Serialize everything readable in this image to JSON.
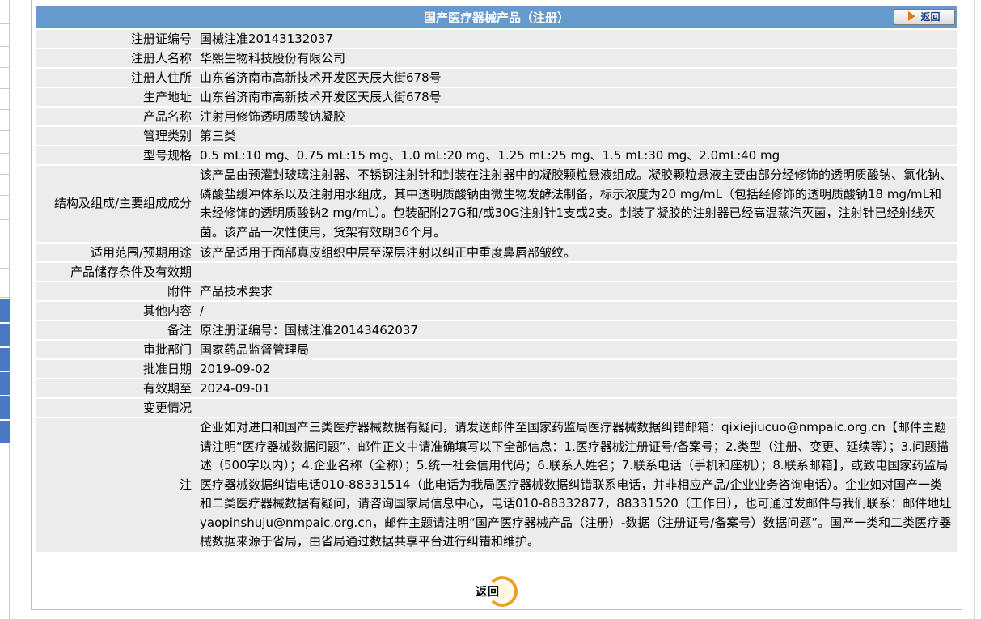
{
  "header": {
    "title": "国产医疗器械产品（注册）",
    "back_button_label": "返回",
    "back_icon": "arrow-right-icon"
  },
  "rows": [
    {
      "label": "注册证编号",
      "value": "国械注准20143132037"
    },
    {
      "label": "注册人名称",
      "value": "华熙生物科技股份有限公司"
    },
    {
      "label": "注册人住所",
      "value": "山东省济南市高新技术开发区天辰大街678号"
    },
    {
      "label": "生产地址",
      "value": "山东省济南市高新技术开发区天辰大街678号"
    },
    {
      "label": "产品名称",
      "value": "注射用修饰透明质酸钠凝胶"
    },
    {
      "label": "管理类别",
      "value": "第三类"
    },
    {
      "label": "型号规格",
      "value": "0.5 mL:10 mg、0.75 mL:15 mg、1.0 mL:20 mg、1.25 mL:25 mg、1.5 mL:30 mg、2.0mL:40 mg"
    },
    {
      "label": "结构及组成/主要组成成分",
      "value": "该产品由预灌封玻璃注射器、不锈钢注射针和封装在注射器中的凝胶颗粒悬液组成。凝胶颗粒悬液主要由部分经修饰的透明质酸钠、氯化钠、磷酸盐缓冲体系以及注射用水组成，其中透明质酸钠由微生物发酵法制备，标示浓度为20 mg/mL（包括经修饰的透明质酸钠18 mg/mL和未经修饰的透明质酸钠2 mg/mL）。包装配附27G和/或30G注射针1支或2支。封装了凝胶的注射器已经高温蒸汽灭菌，注射针已经射线灭菌。该产品一次性使用，货架有效期36个月。"
    },
    {
      "label": "适用范围/预期用途",
      "value": "该产品适用于面部真皮组织中层至深层注射以纠正中重度鼻唇部皱纹。"
    },
    {
      "label": "产品储存条件及有效期",
      "value": ""
    },
    {
      "label": "附件",
      "value": "产品技术要求"
    },
    {
      "label": "其他内容",
      "value": "/"
    },
    {
      "label": "备注",
      "value": "原注册证编号：国械注准20143462037"
    },
    {
      "label": "审批部门",
      "value": "国家药品监督管理局"
    },
    {
      "label": "批准日期",
      "value": "2019-09-02"
    },
    {
      "label": "有效期至",
      "value": "2024-09-01"
    },
    {
      "label": "变更情况",
      "value": ""
    }
  ],
  "note": {
    "label": "注",
    "value": "企业如对进口和国产三类医疗器械数据有疑问，请发送邮件至国家药监局医疗器械数据纠错邮箱：qixiejiucuo@nmpaic.org.cn【邮件主题请注明“医疗器械数据问题”，邮件正文中请准确填写以下全部信息：1.医疗器械注册证号/备案号；2.类型（注册、变更、延续等）；3.问题描述（500字以内）；4.企业名称（全称）；5.统一社会信用代码；6.联系人姓名；7.联系电话（手机和座机）；8.联系邮箱】，或致电国家药监局医疗器械数据纠错电话010-88331514（此电话为我局医疗器械数据纠错联系电话，并非相应产品/企业业务咨询电话）。企业如对国产一类和二类医疗器械数据有疑问，请咨询国家局信息中心，电话010-88332877，88331520（工作日），也可通过发邮件与我们联系：邮件地址yaopinshuju@nmpaic.org.cn，邮件主题请注明“国产医疗器械产品（注册）-数据（注册证号/备案号）数据问题”。国产一类和二类医疗器械数据来源于省局，由省局通过数据共享平台进行纠错和维护。"
  },
  "footer": {
    "back_button_label": "返回"
  },
  "colors": {
    "header_bg": "#6699cc",
    "row_bg": "#ececec",
    "sidebar_accent": "#4a78c2"
  }
}
